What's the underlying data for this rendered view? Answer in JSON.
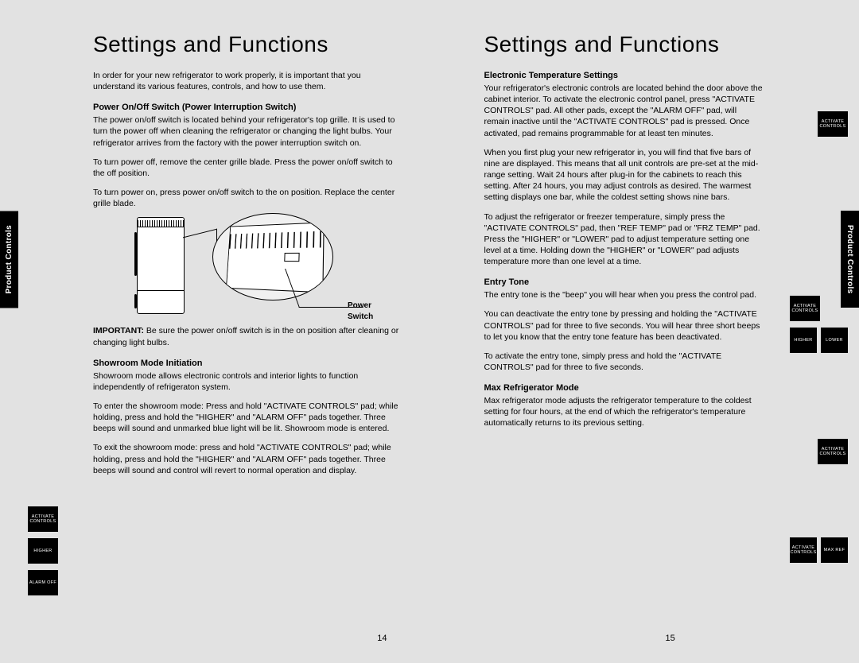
{
  "left": {
    "title": "Settings and Functions",
    "sidetab": "Product Controls",
    "intro": "In order for your new refrigerator to work properly, it is important that you understand its various features, controls, and how to use them.",
    "sec1_title": "Power On/Off Switch (Power Interruption Switch)",
    "sec1_p1": "The power on/off switch is located behind your refrigerator's top grille. It is used to turn the power off when cleaning the refrigerator or changing the light bulbs. Your refrigerator arrives from the factory with the power interruption switch on.",
    "sec1_p2": "To turn power off, remove the center grille blade. Press the power on/off switch to the off position.",
    "sec1_p3": "To turn power on, press power on/off switch to the on position. Replace the center grille blade.",
    "power_switch_label": "Power Switch",
    "important_label": "IMPORTANT:",
    "important_text": " Be sure the power on/off switch is in the on position after cleaning or changing light bulbs.",
    "sec2_title": "Showroom Mode Initiation",
    "sec2_p1": "Showroom mode allows electronic controls and interior lights to function independently of refrigeraton system.",
    "sec2_p2": "To enter the showroom mode: Press and hold \"ACTIVATE CONTROLS\" pad; while holding, press and hold the \"HIGHER\" and \"ALARM OFF\" pads together. Three beeps will sound and unmarked blue light will be lit. Showroom mode is entered.",
    "sec2_p3": "To exit the showroom mode: press and hold \"ACTIVATE CONTROLS\" pad; while holding, press and hold the \"HIGHER\" and \"ALARM OFF\" pads together. Three beeps will sound and control will revert to normal operation and display.",
    "page_num": "14",
    "pads": [
      "ACTIVATE CONTROLS",
      "HIGHER",
      "ALARM OFF"
    ]
  },
  "right": {
    "title": "Settings and Functions",
    "sidetab": "Product Controls",
    "sec1_title": "Electronic Temperature Settings",
    "sec1_p1": "Your refrigerator's electronic controls are located behind the door above the cabinet interior. To activate the electronic control panel, press \"ACTIVATE CONTROLS\" pad. All other pads, except the \"ALARM OFF\" pad, will remain inactive until the \"ACTIVATE CONTROLS\" pad is pressed. Once activated, pad remains programmable for at least ten minutes.",
    "sec1_p2": "When you first plug your new refrigerator in, you will find that five bars of nine are displayed. This means that all unit controls are pre-set at the mid-range setting. Wait 24 hours after plug-in for the cabinets to reach this setting. After 24 hours, you may adjust controls as desired. The warmest setting displays one bar, while the coldest setting shows nine bars.",
    "sec1_p3": "To adjust the refrigerator or freezer temperature, simply press the \"ACTIVATE CONTROLS\" pad, then \"REF TEMP\" pad or \"FRZ TEMP\" pad. Press the \"HIGHER\" or \"LOWER\" pad to adjust temperature setting one level at a time. Holding down the \"HIGHER\" or \"LOWER\" pad adjusts temperature more than one level at a time.",
    "sec2_title": "Entry Tone",
    "sec2_p1": "The entry tone is the \"beep\" you will hear when you press the control pad.",
    "sec2_p2": "You can deactivate the entry tone by pressing and holding the \"ACTIVATE CONTROLS\" pad for three to five seconds. You will hear three short beeps to let you know that the entry tone feature has been deactivated.",
    "sec2_p3": "To activate the entry tone, simply press and hold the \"ACTIVATE CONTROLS\" pad for three to five seconds.",
    "sec3_title": "Max Refrigerator Mode",
    "sec3_p1": "Max refrigerator mode adjusts the refrigerator temperature to the coldest setting for four hours, at the end of which the refrigerator's temperature automatically returns to its previous setting.",
    "page_num": "15",
    "pads_g1": [
      "ACTIVATE CONTROLS"
    ],
    "pads_g2": [
      "ACTIVATE CONTROLS",
      "HIGHER",
      "LOWER"
    ],
    "pads_g3": [
      "ACTIVATE CONTROLS"
    ],
    "pads_g4": [
      "ACTIVATE CONTROLS",
      "MAX REF"
    ]
  }
}
